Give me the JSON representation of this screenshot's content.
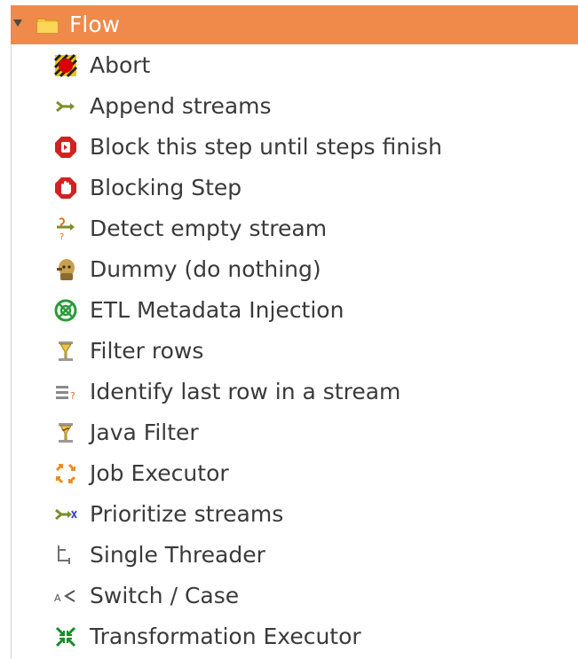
{
  "folder": {
    "label": "Flow",
    "expanded": true,
    "highlight_color": "#f08a4b",
    "icon": "folder-icon"
  },
  "items": [
    {
      "label": "Abort",
      "icon": "abort-icon"
    },
    {
      "label": "Append streams",
      "icon": "append-streams-icon"
    },
    {
      "label": "Block this step until steps finish",
      "icon": "block-until-finish-icon"
    },
    {
      "label": "Blocking Step",
      "icon": "blocking-step-icon"
    },
    {
      "label": "Detect empty stream",
      "icon": "detect-empty-stream-icon"
    },
    {
      "label": "Dummy (do nothing)",
      "icon": "dummy-icon"
    },
    {
      "label": "ETL Metadata Injection",
      "icon": "metadata-injection-icon"
    },
    {
      "label": "Filter rows",
      "icon": "filter-rows-icon"
    },
    {
      "label": "Identify last row in a stream",
      "icon": "identify-last-row-icon"
    },
    {
      "label": "Java Filter",
      "icon": "java-filter-icon"
    },
    {
      "label": "Job Executor",
      "icon": "job-executor-icon"
    },
    {
      "label": "Prioritize streams",
      "icon": "prioritize-streams-icon"
    },
    {
      "label": "Single Threader",
      "icon": "single-threader-icon"
    },
    {
      "label": "Switch / Case",
      "icon": "switch-case-icon"
    },
    {
      "label": "Transformation Executor",
      "icon": "transformation-executor-icon"
    }
  ]
}
